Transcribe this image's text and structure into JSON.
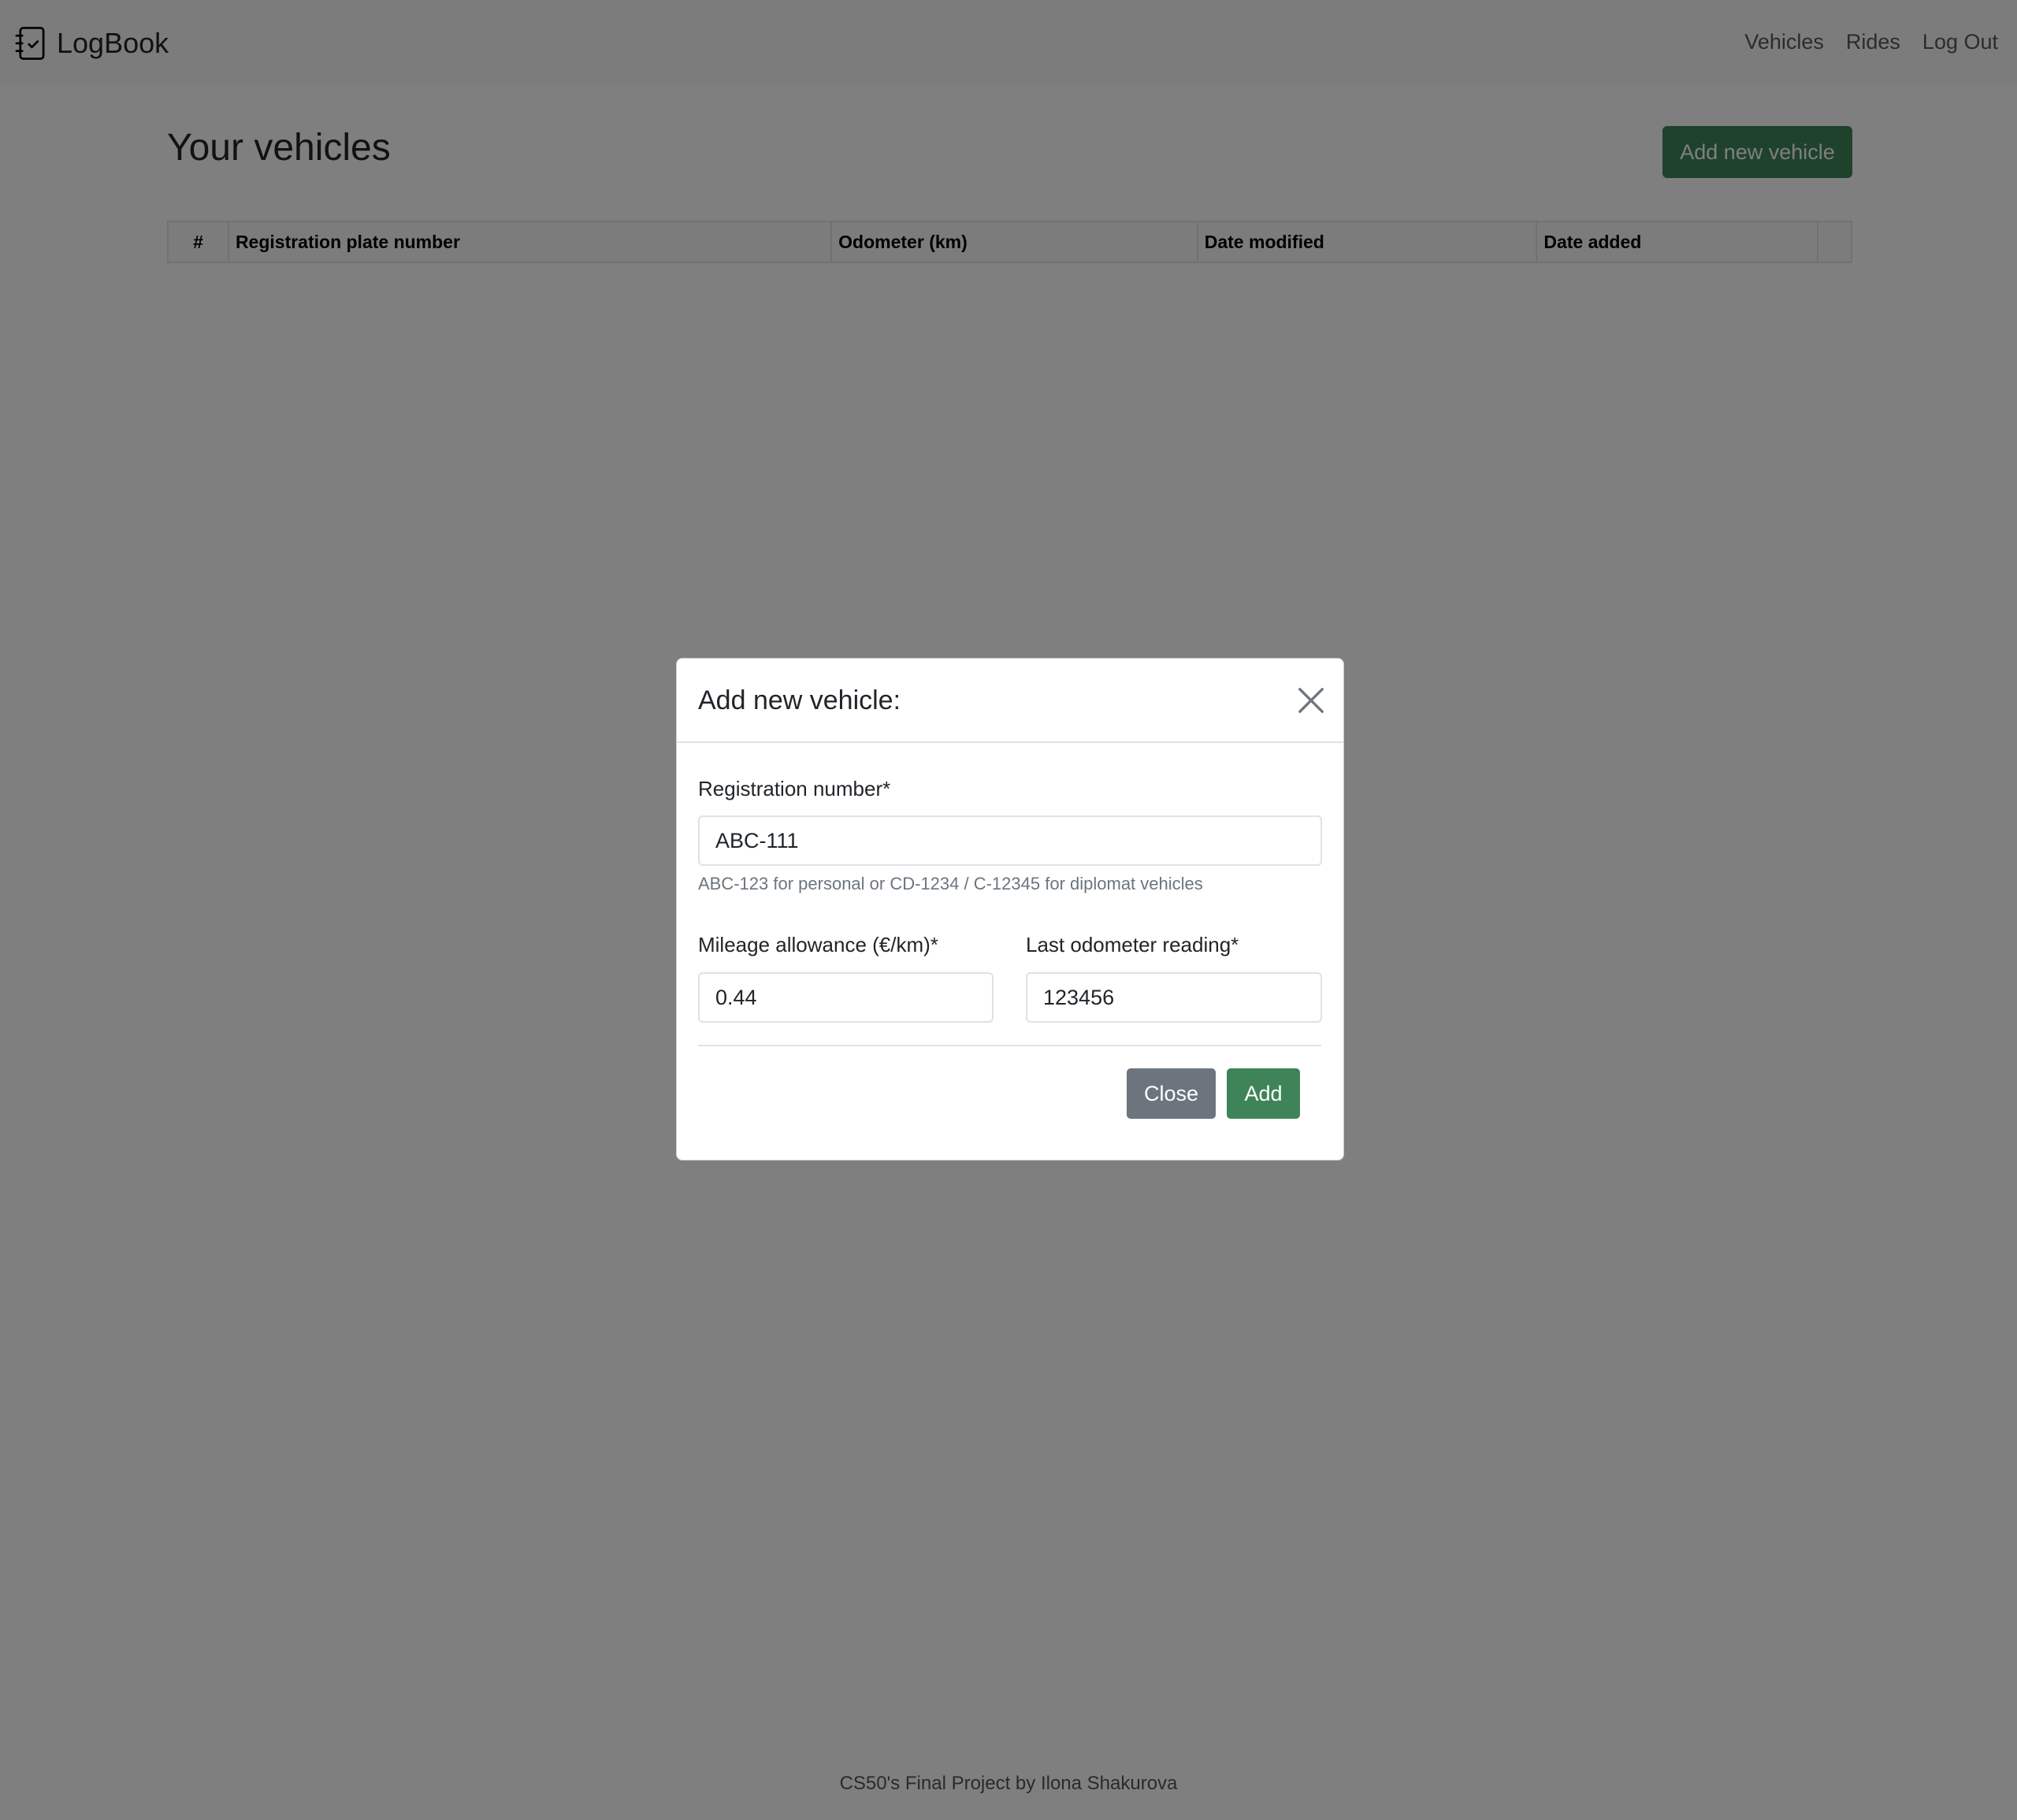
{
  "navbar": {
    "brand": "LogBook",
    "brand_icon": "journal-check-icon",
    "links": [
      {
        "label": "Vehicles"
      },
      {
        "label": "Rides"
      },
      {
        "label": "Log Out"
      }
    ]
  },
  "main": {
    "title": "Your vehicles",
    "add_button_label": "Add new vehicle",
    "table": {
      "columns": [
        "#",
        "Registration plate number",
        "Odometer (km)",
        "Date modified",
        "Date added",
        ""
      ],
      "rows": []
    }
  },
  "modal": {
    "title": "Add new vehicle:",
    "close_icon": "close-x-icon",
    "fields": {
      "registration": {
        "label": "Registration number*",
        "value": "ABC-111",
        "help": "ABC-123 for personal or CD-1234 / C-12345 for diplomat vehicles"
      },
      "mileage": {
        "label": "Mileage allowance (€/km)*",
        "value": "0.44"
      },
      "odometer": {
        "label": "Last odometer reading*",
        "value": "123456"
      }
    },
    "buttons": {
      "close": "Close",
      "add": "Add"
    }
  },
  "footer": {
    "text": "CS50's Final Project by Ilona Shakurova"
  },
  "colors": {
    "primary_green": "#3f8458",
    "secondary_gray": "#6c757d",
    "backdrop": "rgba(0,0,0,0.5)"
  }
}
